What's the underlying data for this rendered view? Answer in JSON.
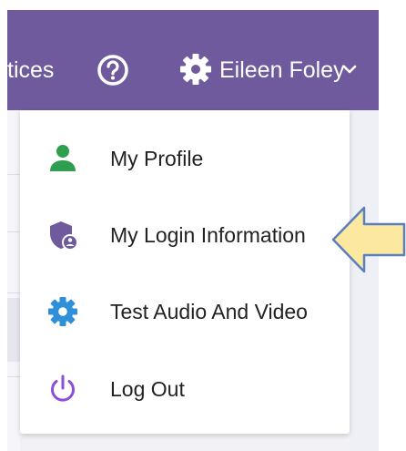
{
  "header": {
    "notices_label": "tices",
    "user_name": "Eileen Foley",
    "icons": [
      "help-icon",
      "gear-icon",
      "chevron-down-icon"
    ],
    "bar_color": "#6e5a9c"
  },
  "user_menu": {
    "items": [
      {
        "label": "My Profile",
        "icon": "person-icon",
        "icon_color": "#2e9f4e"
      },
      {
        "label": "My Login Information",
        "icon": "shield-user-icon",
        "icon_color": "#6e5a9c"
      },
      {
        "label": "Test Audio And Video",
        "icon": "gear-icon",
        "icon_color": "#2f8fd8"
      },
      {
        "label": "Log Out",
        "icon": "power-icon",
        "icon_color": "#8b4fd8"
      }
    ]
  },
  "annotation": {
    "icon": "left-arrow-callout-icon",
    "fill_color": "#fde8a0",
    "stroke_color": "#5a7fbf"
  }
}
